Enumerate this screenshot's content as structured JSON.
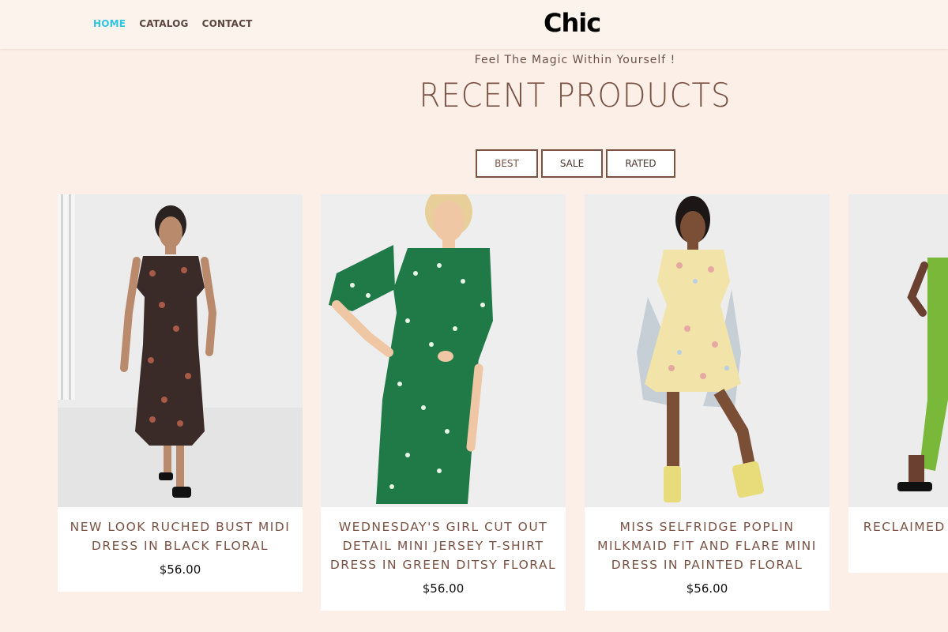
{
  "header": {
    "nav": [
      {
        "label": "HOME",
        "active": true
      },
      {
        "label": "CATALOG",
        "active": false
      },
      {
        "label": "CONTACT",
        "active": false
      }
    ],
    "logo": "Chic"
  },
  "hero": {
    "tagline": "Feel The Magic Within Yourself !",
    "title": "RECENT PRODUCTS"
  },
  "filters": [
    "BEST",
    "SALE",
    "RATED"
  ],
  "products": [
    {
      "title": "NEW LOOK RUCHED BUST MIDI DRESS IN BLACK FLORAL",
      "price": "$56.00"
    },
    {
      "title": "WEDNESDAY'S GIRL CUT OUT DETAIL MINI JERSEY T-SHIRT DRESS IN GREEN DITSY FLORAL",
      "price": "$56.00"
    },
    {
      "title": "MISS SELFRIDGE POPLIN MILKMAID FIT AND FLARE MINI DRESS IN PAINTED FLORAL",
      "price": "$56.00"
    },
    {
      "title": "RECLAIMED KNITTED MID OUT",
      "price": "$"
    }
  ],
  "colors": {
    "background": "#fcefe7",
    "accent": "#2fc4e0",
    "brand_brown": "#7a5244"
  }
}
